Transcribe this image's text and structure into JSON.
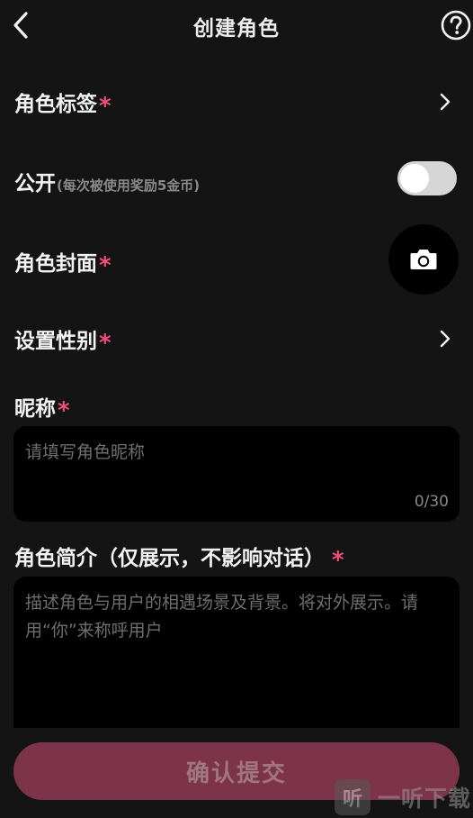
{
  "header": {
    "title": "创建角色",
    "back_icon": "chevron-left-icon",
    "help_icon": "help-circle-icon"
  },
  "form": {
    "required_mark": "*",
    "tags": {
      "label": "角色标签",
      "required": true
    },
    "public": {
      "label": "公开",
      "hint": "(每次被使用奖励5金币)",
      "enabled": false
    },
    "cover": {
      "label": "角色封面",
      "required": true,
      "icon": "camera-icon"
    },
    "gender": {
      "label": "设置性别",
      "required": true
    },
    "nickname": {
      "label": "昵称",
      "required": true,
      "placeholder": "请填写角色昵称",
      "counter": "0/30"
    },
    "intro": {
      "label": "角色简介（仅展示，不影响对话）",
      "required": true,
      "placeholder": "描述角色与用户的相遇场景及背景。将对外展示。请用“你”来称呼用户"
    }
  },
  "submit": {
    "label": "确认提交"
  },
  "watermark": {
    "logo_char": "听",
    "text": "一听下载"
  },
  "colors": {
    "background": "#141414",
    "accent": "#f04d78",
    "submit_bg": "#7d3349"
  }
}
